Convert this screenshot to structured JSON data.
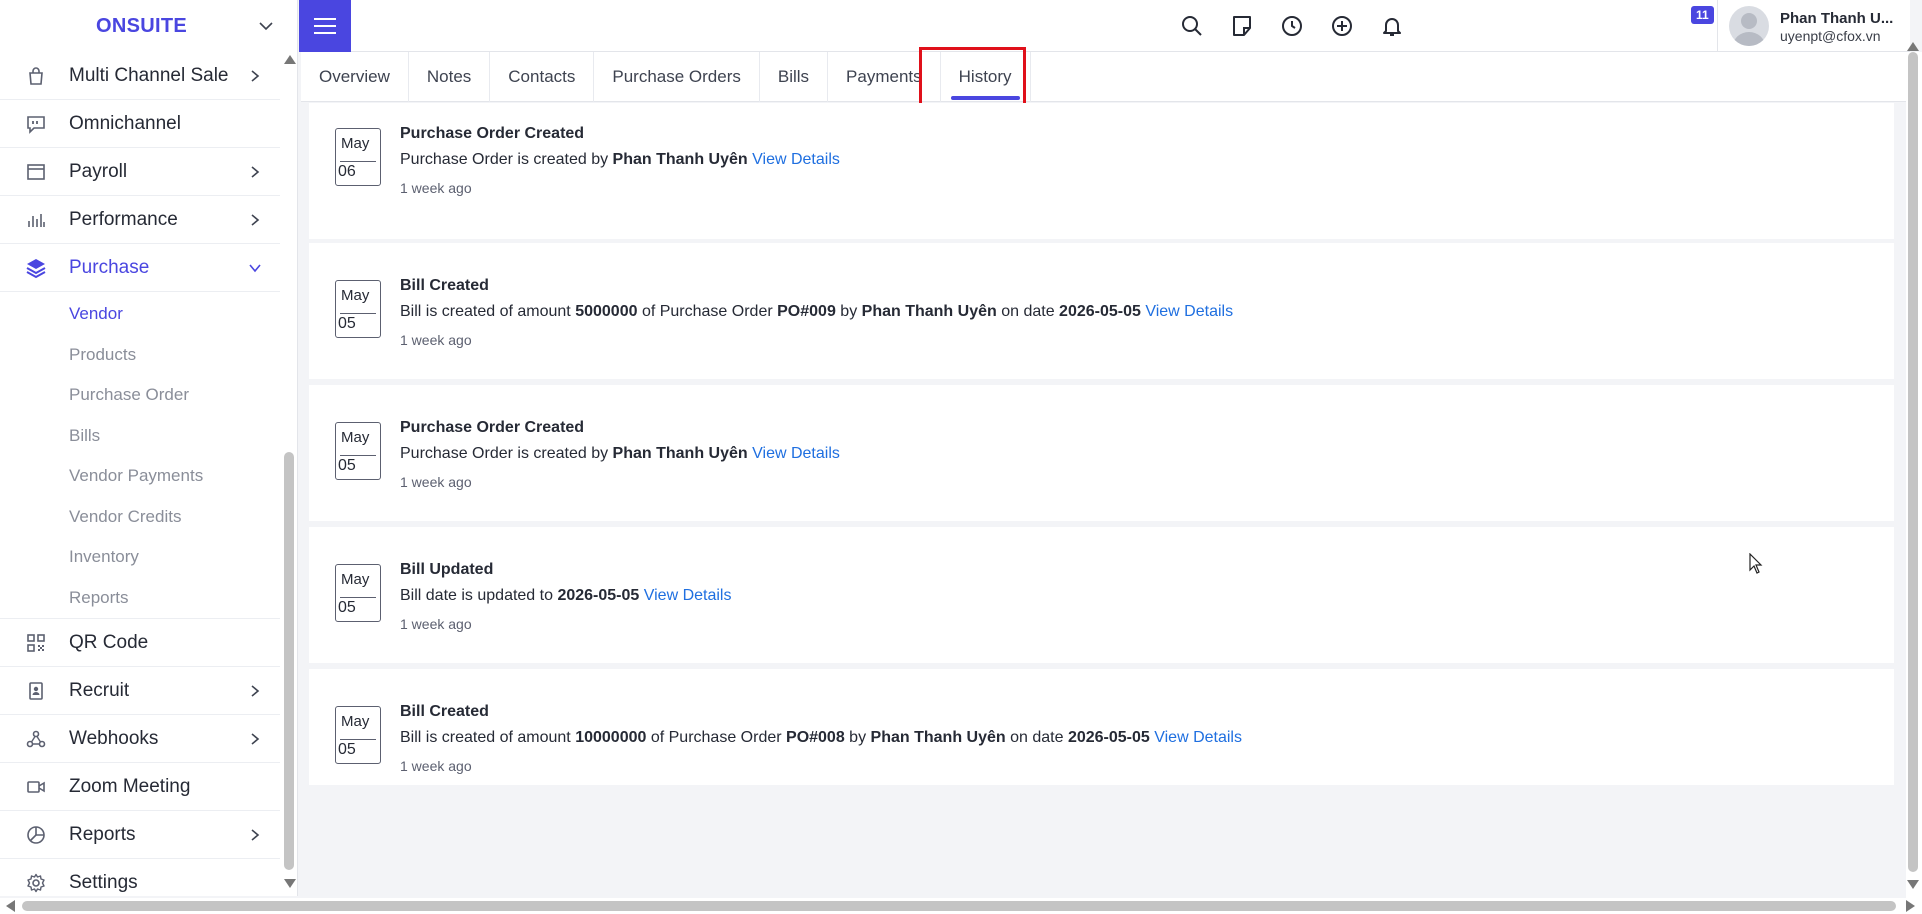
{
  "app": {
    "brand": "ONSUITE"
  },
  "sidebar": {
    "items": [
      {
        "label": "Multi Channel Sale",
        "icon": "bag-icon",
        "chevron": true
      },
      {
        "label": "Omnichannel",
        "icon": "chat-quote-icon",
        "chevron": false
      },
      {
        "label": "Payroll",
        "icon": "window-icon",
        "chevron": true
      },
      {
        "label": "Performance",
        "icon": "bar-chart-icon",
        "chevron": true
      },
      {
        "label": "Purchase",
        "icon": "layers-icon",
        "chevron": true,
        "expanded": true
      }
    ],
    "purchase_sub": [
      {
        "label": "Vendor",
        "active": true
      },
      {
        "label": "Products"
      },
      {
        "label": "Purchase Order"
      },
      {
        "label": "Bills"
      },
      {
        "label": "Vendor Payments"
      },
      {
        "label": "Vendor Credits"
      },
      {
        "label": "Inventory"
      },
      {
        "label": "Reports"
      }
    ],
    "items_after": [
      {
        "label": "QR Code",
        "icon": "qr-code-icon",
        "chevron": false
      },
      {
        "label": "Recruit",
        "icon": "id-badge-icon",
        "chevron": true
      },
      {
        "label": "Webhooks",
        "icon": "webhook-icon",
        "chevron": true
      },
      {
        "label": "Zoom Meeting",
        "icon": "video-camera-icon",
        "chevron": false
      },
      {
        "label": "Reports",
        "icon": "pie-chart-icon",
        "chevron": true
      },
      {
        "label": "Settings",
        "icon": "gear-icon",
        "chevron": false
      }
    ]
  },
  "header": {
    "notification_count": "11",
    "user_name": "Phan Thanh U...",
    "user_email": "uyenpt@cfox.vn"
  },
  "tabs": [
    {
      "label": "Overview"
    },
    {
      "label": "Notes"
    },
    {
      "label": "Contacts"
    },
    {
      "label": "Purchase Orders"
    },
    {
      "label": "Bills"
    },
    {
      "label": "Payments"
    },
    {
      "label": "History",
      "active": true
    }
  ],
  "history": [
    {
      "month": "May",
      "day": "06",
      "title": "Purchase Order Created",
      "parts": [
        [
          "t",
          "Purchase Order is created by "
        ],
        [
          "b",
          "Phan Thanh Uyên"
        ],
        [
          "t",
          " "
        ],
        [
          "a",
          "View Details"
        ]
      ],
      "time": "1 week ago"
    },
    {
      "month": "May",
      "day": "05",
      "title": "Bill Created",
      "parts": [
        [
          "t",
          "Bill is created of amount "
        ],
        [
          "b",
          "5000000"
        ],
        [
          "t",
          " of Purchase Order "
        ],
        [
          "b",
          "PO#009"
        ],
        [
          "t",
          " by "
        ],
        [
          "b",
          "Phan Thanh Uyên"
        ],
        [
          "t",
          " on date "
        ],
        [
          "b",
          "2026-05-05"
        ],
        [
          "t",
          " "
        ],
        [
          "a",
          "View Details"
        ]
      ],
      "time": "1 week ago"
    },
    {
      "month": "May",
      "day": "05",
      "title": "Purchase Order Created",
      "parts": [
        [
          "t",
          "Purchase Order is created by "
        ],
        [
          "b",
          "Phan Thanh Uyên"
        ],
        [
          "t",
          " "
        ],
        [
          "a",
          "View Details"
        ]
      ],
      "time": "1 week ago"
    },
    {
      "month": "May",
      "day": "05",
      "title": "Bill Updated",
      "parts": [
        [
          "t",
          "Bill date is updated to "
        ],
        [
          "b",
          "2026-05-05"
        ],
        [
          "t",
          " "
        ],
        [
          "a",
          "View Details"
        ]
      ],
      "time": "1 week ago"
    },
    {
      "month": "May",
      "day": "05",
      "title": "Bill Created",
      "parts": [
        [
          "t",
          "Bill is created of amount "
        ],
        [
          "b",
          "10000000"
        ],
        [
          "t",
          " of Purchase Order "
        ],
        [
          "b",
          "PO#008"
        ],
        [
          "t",
          " by "
        ],
        [
          "b",
          "Phan Thanh Uyên"
        ],
        [
          "t",
          " on date "
        ],
        [
          "b",
          "2026-05-05"
        ],
        [
          "t",
          " "
        ],
        [
          "a",
          "View Details"
        ]
      ],
      "time": "1 week ago"
    }
  ],
  "colors": {
    "accent": "#4a46e0",
    "link": "#1f6fe0",
    "highlight": "#e0101a"
  }
}
